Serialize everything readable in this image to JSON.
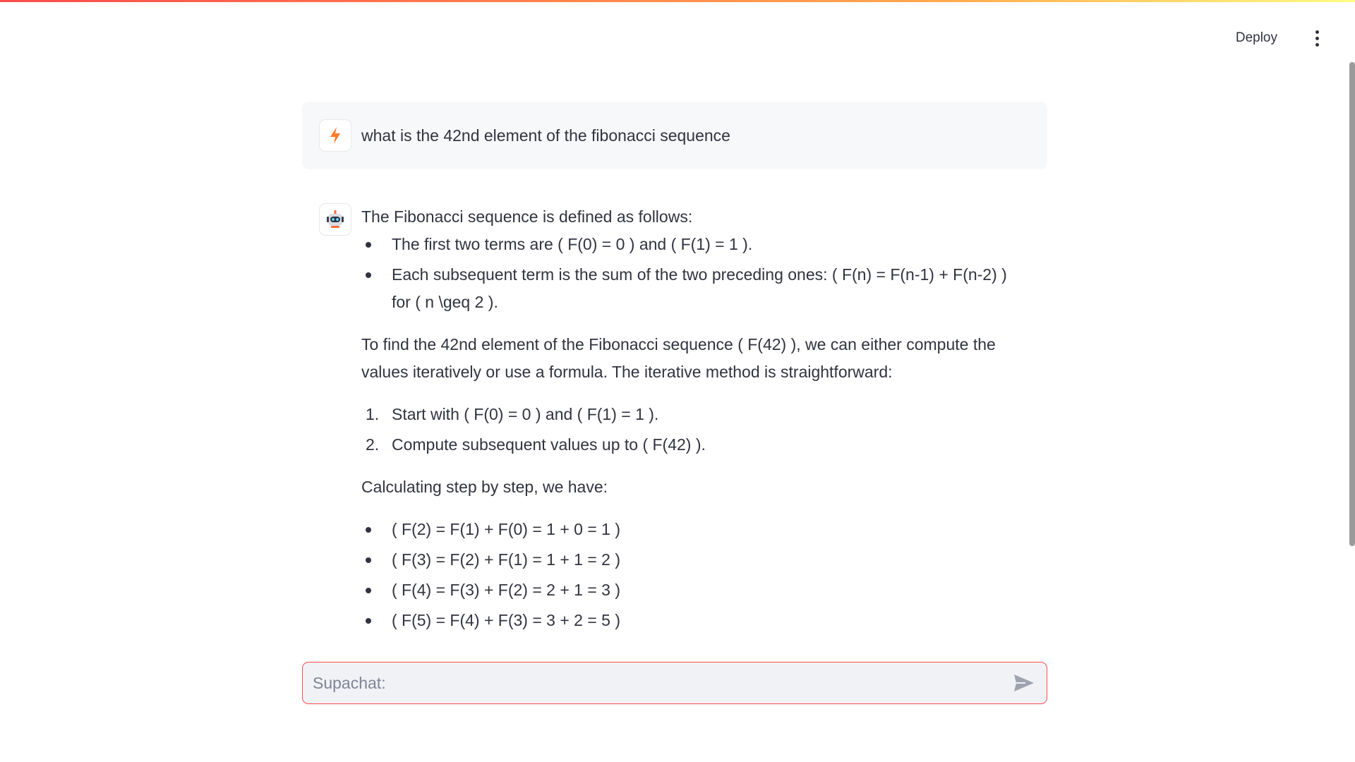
{
  "header": {
    "deploy_label": "Deploy",
    "menu_icon": "kebab-menu-icon"
  },
  "user_message": {
    "avatar_icon": "lightning-bolt-icon",
    "text": "what is the 42nd element of the fibonacci sequence"
  },
  "assistant_message": {
    "avatar_icon": "robot-icon",
    "intro": "The Fibonacci sequence is defined as follows:",
    "definition_items": [
      "The first two terms are ( F(0) = 0 ) and ( F(1) = 1 ).",
      "Each subsequent term is the sum of the two preceding ones: ( F(n) = F(n-1) + F(n-2) ) for ( n \\geq 2 )."
    ],
    "method_paragraph": "To find the 42nd element of the Fibonacci sequence ( F(42) ), we can either compute the values iteratively or use a formula. The iterative method is straightforward:",
    "steps": [
      {
        "num": "1.",
        "text": "Start with ( F(0) = 0 ) and ( F(1) = 1 )."
      },
      {
        "num": "2.",
        "text": "Compute subsequent values up to ( F(42) )."
      }
    ],
    "calc_intro": "Calculating step by step, we have:",
    "calc_items": [
      "( F(2) = F(1) + F(0) = 1 + 0 = 1 )",
      "( F(3) = F(2) + F(1) = 1 + 1 = 2 )",
      "( F(4) = F(3) + F(2) = 2 + 1 = 3 )",
      "( F(5) = F(4) + F(3) = 3 + 2 = 5 )"
    ]
  },
  "chat_input": {
    "placeholder": "Supachat:",
    "value": "",
    "send_icon": "send-arrow-icon"
  },
  "colors": {
    "accent": "#ff4b4b",
    "text": "#31333f",
    "user_bubble_bg": "#f7f8fa",
    "input_bg": "#f0f2f6"
  }
}
